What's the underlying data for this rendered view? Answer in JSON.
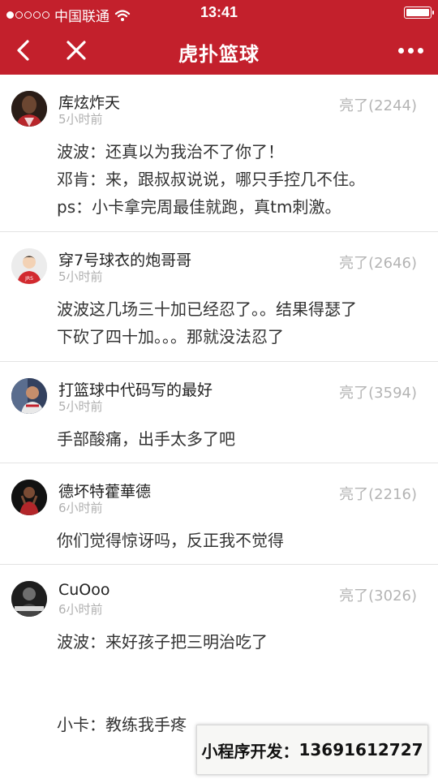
{
  "status_bar": {
    "carrier": "中国联通",
    "time": "13:41",
    "signal_dots_filled": 1,
    "signal_dots_total": 5,
    "battery_level": 1.0
  },
  "nav": {
    "title": "虎扑篮球",
    "back_icon": "chevron-left-icon",
    "close_icon": "close-icon",
    "more_icon": "more-dots-icon"
  },
  "colors": {
    "brand": "#c3202c",
    "muted": "#b4b4b4",
    "text": "#333333",
    "divider": "#e3e3e3"
  },
  "comments": [
    {
      "user": "库炫炸天",
      "time": "5小时前",
      "likes": "亮了(2244)",
      "lines": [
        "波波：还真以为我治不了你了！",
        "邓肯：来，跟叔叔说说，哪只手控几不住。",
        "ps：小卡拿完周最佳就跑，真tm刺激。"
      ]
    },
    {
      "user": "穿7号球衣的炮哥哥",
      "time": "5小时前",
      "likes": "亮了(2646)",
      "lines": [
        "波波这几场三十加已经忍了。。结果得瑟了",
        "下砍了四十加。。。那就没法忍了"
      ]
    },
    {
      "user": "打篮球中代码写的最好",
      "time": "5小时前",
      "likes": "亮了(3594)",
      "lines": [
        "手部酸痛，出手太多了吧"
      ]
    },
    {
      "user": "德坏特藿華德",
      "time": "6小时前",
      "likes": "亮了(2216)",
      "lines": [
        "你们觉得惊讶吗，反正我不觉得"
      ]
    },
    {
      "user": "CuOoo",
      "time": "6小时前",
      "likes": "亮了(3026)",
      "lines": [
        "波波：来好孩子把三明治吃了",
        "",
        "",
        "小卡：教练我手疼"
      ]
    }
  ],
  "watermark": {
    "label": "小程序开发：",
    "phone": "13691612727"
  }
}
